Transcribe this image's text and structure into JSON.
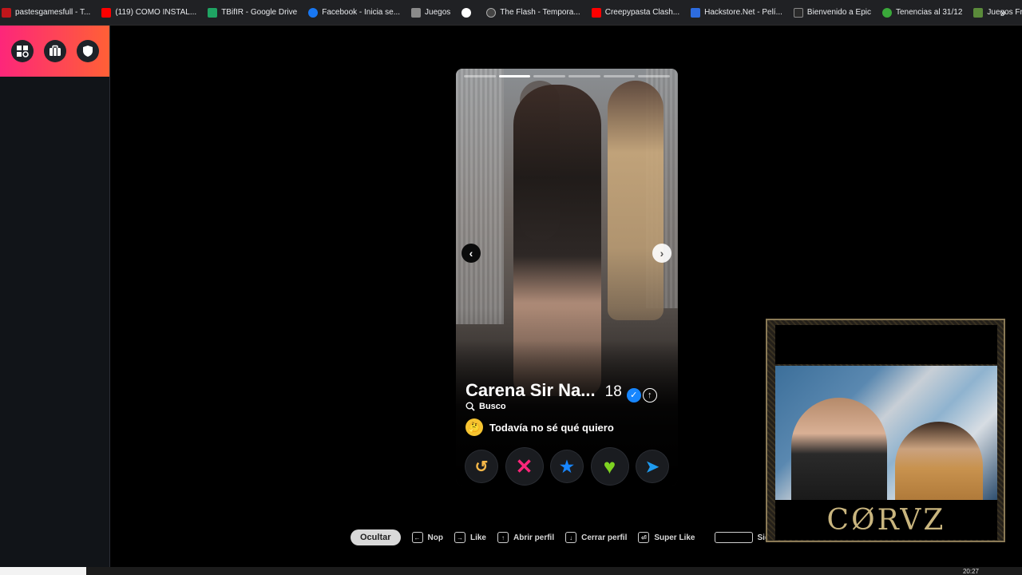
{
  "bookmarks": [
    {
      "label": "pastesgamesfull - T...",
      "color": "#c0161b"
    },
    {
      "label": "(119) COMO INSTAL...",
      "color": "#ff0000"
    },
    {
      "label": "TBifIR - Google Drive",
      "color": "#1fa463"
    },
    {
      "label": "Facebook - Inicia se...",
      "color": "#1877f2"
    },
    {
      "label": "Juegos",
      "color": "#8a8a8a"
    },
    {
      "label": "G",
      "color": "#ffffff"
    },
    {
      "label": "The Flash - Tempora...",
      "color": "#444444"
    },
    {
      "label": "Creepypasta Clash...",
      "color": "#ff0000"
    },
    {
      "label": "Hackstore.Net - Pelí...",
      "color": "#2d6cdf"
    },
    {
      "label": "Bienvenido a Epic",
      "color": "#2a2a2a"
    },
    {
      "label": "Tenencias al 31/12",
      "color": "#3aa83a"
    },
    {
      "label": "Juegos Friv",
      "color": "#5a8a3a"
    }
  ],
  "bookmarks_more": "»",
  "sidebar": {
    "accent_gradient": [
      "#fd267a",
      "#ff6036"
    ],
    "buttons": [
      "explore-icon",
      "briefcase-icon",
      "shield-icon"
    ]
  },
  "profile": {
    "name": "Carena Sir Na...",
    "age": "18",
    "verified_glyph": "✓",
    "boost_glyph": "↑",
    "looking_label": "Busco",
    "intent_emoji": "🤔",
    "intent": "Todavía no sé qué quiero",
    "photo_count": 6,
    "active_photo": 1
  },
  "actions": [
    {
      "name": "rewind-button",
      "glyph": "↺",
      "color": "#f5b748"
    },
    {
      "name": "nope-button",
      "glyph": "✕",
      "color": "#fd267a"
    },
    {
      "name": "super-like-button",
      "glyph": "★",
      "color": "#1786ff"
    },
    {
      "name": "like-button",
      "glyph": "♥",
      "color": "#7ed321"
    },
    {
      "name": "boost-button",
      "glyph": "➤",
      "color": "#1e9bf0"
    }
  ],
  "shortcuts": {
    "hide_label": "Ocultar",
    "items": [
      {
        "key": "←",
        "label": "Nop"
      },
      {
        "key": "→",
        "label": "Like"
      },
      {
        "key": "↑",
        "label": "Abrir perfil"
      },
      {
        "key": "↓",
        "label": "Cerrar perfil"
      },
      {
        "key": "⏎",
        "label": "Super Like"
      }
    ],
    "next_label": "Siguiente"
  },
  "webcam": {
    "brand": "CØRVZ"
  },
  "taskbar": {
    "clock": "20:27"
  }
}
